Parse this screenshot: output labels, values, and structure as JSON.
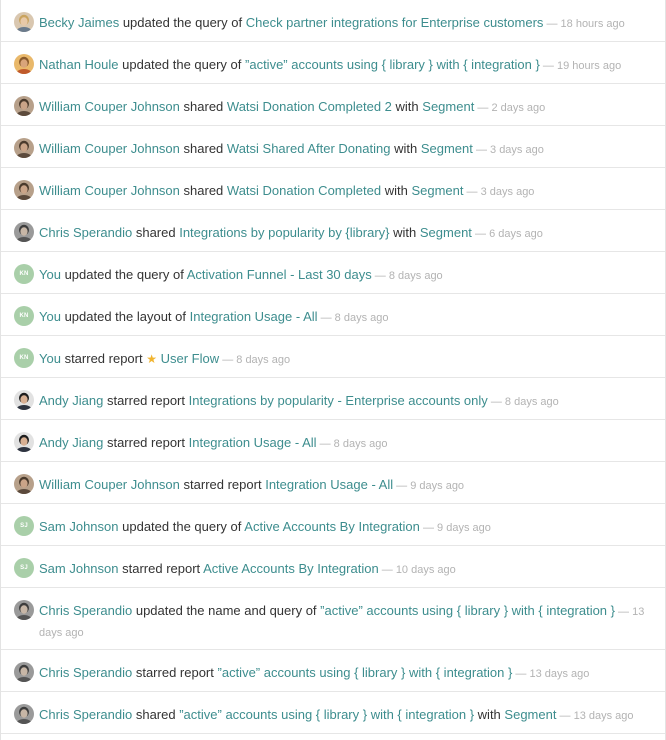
{
  "separator": " — ",
  "star_glyph": "★",
  "colors": {
    "link": "#3d8d8e",
    "muted": "#b3b3b3",
    "text": "#333333",
    "initials_avatar": "#a9cfa9",
    "star": "#f1b42f"
  },
  "items": [
    {
      "user": "Becky Jaimes",
      "avatar": "photo-blonde",
      "action": "updated the query of",
      "target": "Check partner integrations for Enterprise customers",
      "time": "18 hours ago"
    },
    {
      "user": "Nathan Houle",
      "avatar": "photo-orange",
      "action": "updated the query of",
      "target": "”active” accounts using { library } with { integration }",
      "time": "19 hours ago"
    },
    {
      "user": "William Couper Johnson",
      "avatar": "photo-tan",
      "action": "shared",
      "target": "Watsi Donation Completed 2",
      "with_label": "with",
      "with_target": "Segment",
      "time": "2 days ago"
    },
    {
      "user": "William Couper Johnson",
      "avatar": "photo-tan",
      "action": "shared",
      "target": "Watsi Shared After Donating",
      "with_label": "with",
      "with_target": "Segment",
      "time": "3 days ago"
    },
    {
      "user": "William Couper Johnson",
      "avatar": "photo-tan",
      "action": "shared",
      "target": "Watsi Donation Completed",
      "with_label": "with",
      "with_target": "Segment",
      "time": "3 days ago"
    },
    {
      "user": "Chris Sperandio",
      "avatar": "photo-gray",
      "action": "shared",
      "target": "Integrations by popularity by {library}",
      "with_label": "with",
      "with_target": "Segment",
      "time": "6 days ago"
    },
    {
      "user": "You",
      "avatar": "initials",
      "initials": "KN",
      "action": "updated the query of",
      "target": "Activation Funnel - Last 30 days",
      "time": "8 days ago"
    },
    {
      "user": "You",
      "avatar": "initials",
      "initials": "KN",
      "action": "updated the layout of",
      "target": "Integration Usage - All",
      "time": "8 days ago"
    },
    {
      "user": "You",
      "avatar": "initials",
      "initials": "KN",
      "action": "starred report",
      "star": true,
      "target": "User Flow",
      "time": "8 days ago"
    },
    {
      "user": "Andy Jiang",
      "avatar": "photo-dark",
      "action": "starred report",
      "target": "Integrations by popularity - Enterprise accounts only",
      "time": "8 days ago"
    },
    {
      "user": "Andy Jiang",
      "avatar": "photo-dark",
      "action": "starred report",
      "target": "Integration Usage - All",
      "time": "8 days ago"
    },
    {
      "user": "William Couper Johnson",
      "avatar": "photo-tan",
      "action": "starred report",
      "target": "Integration Usage - All",
      "time": "9 days ago"
    },
    {
      "user": "Sam Johnson",
      "avatar": "initials",
      "initials": "SJ",
      "action": "updated the query of",
      "target": "Active Accounts By Integration",
      "time": "9 days ago"
    },
    {
      "user": "Sam Johnson",
      "avatar": "initials",
      "initials": "SJ",
      "action": "starred report",
      "target": "Active Accounts By Integration",
      "time": "10 days ago"
    },
    {
      "user": "Chris Sperandio",
      "avatar": "photo-gray",
      "action": "updated the name and query of",
      "target": "”active” accounts using { library } with { integration }",
      "time": "13 days ago"
    },
    {
      "user": "Chris Sperandio",
      "avatar": "photo-gray",
      "action": "starred report",
      "target": "”active” accounts using { library } with { integration }",
      "time": "13 days ago"
    },
    {
      "user": "Chris Sperandio",
      "avatar": "photo-gray",
      "action": "shared",
      "target": "”active” accounts using { library } with { integration }",
      "with_label": "with",
      "with_target": "Segment",
      "time": "13 days ago"
    }
  ]
}
